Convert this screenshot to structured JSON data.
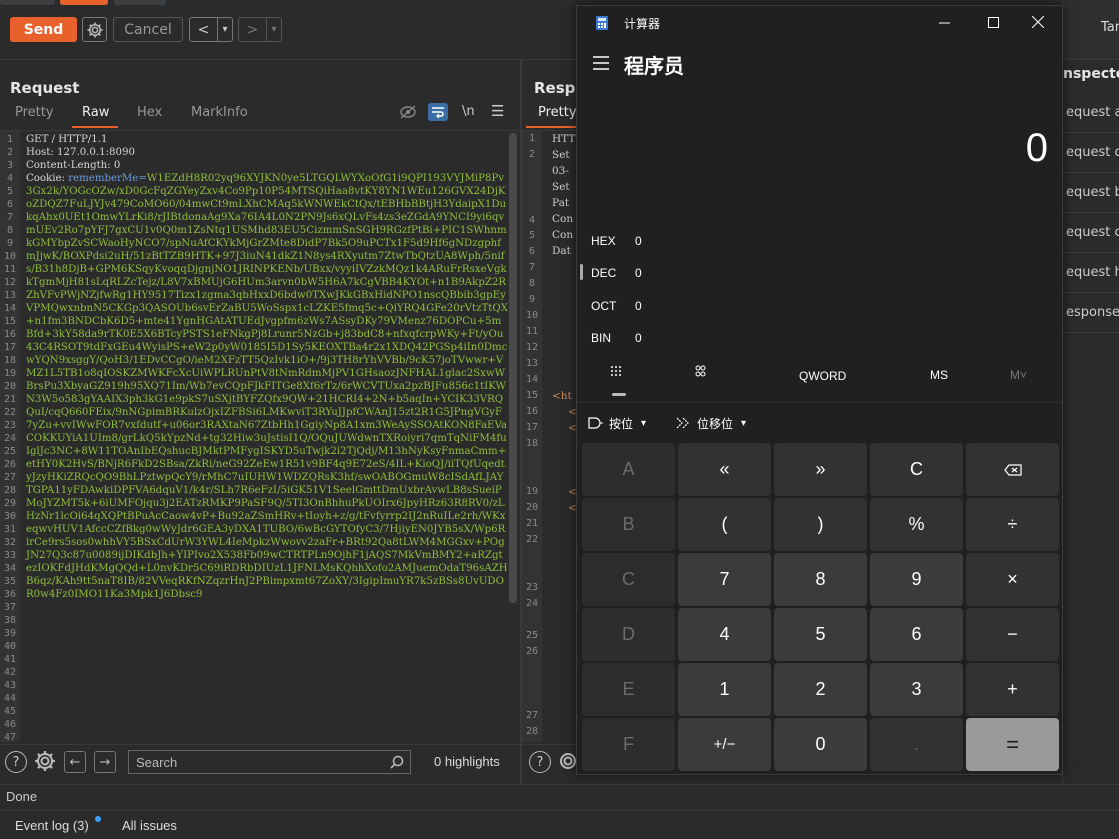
{
  "toolbar": {
    "send": "Send",
    "cancel": "Cancel",
    "back": "<",
    "forward": ">",
    "dropdown": "▾"
  },
  "request": {
    "title": "Request",
    "tabs": [
      "Pretty",
      "Raw",
      "Hex",
      "MarkInfo"
    ],
    "newline_label": "\\n",
    "line_numbers": [
      "1",
      "2",
      "3",
      "4",
      "5",
      "6",
      "7",
      "8",
      "9",
      "10",
      "11",
      "12",
      "13",
      "14",
      "15",
      "16",
      "17",
      "18",
      "19",
      "20",
      "21",
      "22",
      "23",
      "24",
      "25",
      "26",
      "27",
      "28",
      "29",
      "30",
      "31",
      "32",
      "33",
      "34",
      "35",
      "36",
      "37",
      "38",
      "39",
      "40",
      "41",
      "42",
      "43",
      "44",
      "45",
      "46",
      "47"
    ],
    "lines": [
      "GET / HTTP/1.1",
      "Host: 127.0.0.1:8090",
      "Content-Length: 0",
      "Cookie: "
    ],
    "cookie_name": "rememberMe=",
    "cookie_value": "W1EZdH8R02yq96XYJKN0ye5LTGQLWYXoOfG1i9QPI193VYJMiP8Pv3Gx2k/YOGcOZw/xD0GcFqZGYeyZxv4Co9Pp10P54MTSQiHaa8vtKY8YN1WEu126GVX24DjKoZDQZ7FuLJYJv479CoMO60/04mwCt9mLXhCMAq5kWNWEkCtQx/tEBHbBBtjH3YdaipX1DukqAhx0UEt1OmwYLrKi8/rJIBtdonaAg9Xa76IA4L0N2PN9Js6xQLvFs4zs3eZGdA9YNCI9yi6qvmUEv2Ro7pYFJ7gxCU1v0Q0m1ZsNtq1USMhd83EU5CizmmSnSGH9RGzfPtBi+PIC1SWhnmkGMYbpZvSCWaoHyNCO7/spNuAfCKYkMjGrZMte8DidP7Bk5O9uPCTx1F5d9Hf6gNDzgphfmJjwK/BOXPdsi2uH/51zBtTZB9HTK+97J3iuN41dkZ1N8ys4RXyutm7ZtwTbQtzUA8Wph/5nifs/B31h8DjB+GPM6KSqyKvoqqDjgnjNO1JRINPKENb/UBxx/vyyiIVZzkMQz1k4ARuFrRsxeVgkkTgmMjH81sLqRLZcTejz/L8V7xBMUjG6HUm3arvn0bW5H6A7kCgVBB4KYOt+n1B9AkpZ2RZhVFvPWjNZjfwRg1HY9517Tizx1zgma3qbHxxD6bdw0TXwJKkGBxHidNPO1nscQBbib3gpEyVPMQwxnbnN5CKGp3QASOUb6svErZaBU5WoSspx1cLZKE5fmq5c+QiYRQ4GFe20rVtzTtQX+n1fm3BNDCbK6D5+mte41YgnHGAtATUEdJvgpfm6zWs7ASsyDKy79VMenz76DOPCu+5mBfd+3kY58da9rTK0E5X6BTcyPSTS1eFNkgPj8Lrunr5NzGb+j83bdC8+nfxqfcrpWKy+Ft/yOu43C4RSOT9tdFxGEu4WyisPS+eW2p0yW0185I5D1Sy5KEOXTBa4r2x1XDQ42PGSp4iIn0DmcwYQN9xsggY/QoH3/1EDvCCgO/ieM2XFzTT5QzIvk1iO+/9j3TH8rYhVVBb/9cK57joTVwwr+VMZ1L5TB1o8qIOSKZMWKFcXcUiWPLRUnPtV8tNmRdmMjPV1GHsaozJNFHAL1glac2SxwWBrsPu3XbyaGZ919h95XQ71Im/Wb7evCQpFJkFITGe8Xf6rTz/6rWCVTUxa2pzBJFu856c1tIKWN3W5o583gYAAIX3ph3kG1e9pkS7uSXjtBYFZQfx9QW+21HCRI4+2N+b5aqIn+YCIK33VRQQuI/cqQ660FEix/9nNGpimBRKulzOjxIZFBSi6LMKwviT3RYuJJpfCWAnJ15zt2R1G5JPngVGyF7yZu+vvIWwFOR7vxfdutf+u06or3RAXtaN67ZtbHh1GgiyNp8A1xm3WeAySSOAtKON8FaEVaCOKKUYiA1UIm8/grLkQ5kYpzNd+tg32Hiw3uJstisI1Q/OQuJUWdwnTXRoiyri7qmTqNiFM4fuIglJc3NC+8W11TOAnIbEQshucBJMktPMFygISKYD5uTwjk2i2TjQdj/M13hNyKsyFnmaCmm+etHY0K2HvS/BNjR6FkD2SBsa/ZkRi/neG92ZeEw1R51v9BF4q9E72eS/4IL+KioQJ/iiTQfUqedtyJzyHKiZRQcQO9BhLPztwpQcY9/rMhC7uIUHW1WDZQRsK3hf/swOABOGmuW8cISdAfLJAYTGPA11yFDAwkiDPFVA6dquV1/k4r/SLh7R6eFzI/5iGK51V1SeelGmttDmUxbrAvwLB8sSueiPMoJYZMT5k+6iUMFOjqu3j2EATzRMKP9PaSF9Q/5TI3OnBhhuPkUOIrx6JpyHRz63R8RV0/zLHzNr1lcOi64qXQPtBPuAcCaow4vP+Bu92aZSmHRv+tIoyh+z/g/tFvfyrrp2IJ2nRuILe2rh/WKxeqwvHUV1AfccCZfBkg0wWyJdr6GEA3yDXA1TUBO/6wBcGYTOfyC3/7HjiyEN0JYB5sX/Wp6RirCe9rs5sos0whhVY5BSxCdUrW3YWL4IeMpkzWwovv2zaFr+BRt92Qa8tLWM4MGGxv+POgJN27Q3c87u0089ijDIKdbJh+YIPIvo2X538Fb09wCTRTPLn9OjhF1jAQS7MkVmBMY2+aRZgtezIOKFdJHdKMgQQd+L0nvKDr5C69iRDRbDIUzL1JFNLMsKQhhXofo2AMJuemOdaT96sAZHB6qz/KAh9tt5naT8IB/82VVeqRKfNZqzrHnJ2PBimpxmt67ZoXY/3IgipImuYR7k5zBSs8UvUDOR0w4Fz0IMO11Ka3Mpk1J6Dbsc9"
  },
  "response": {
    "title": "Respo",
    "tab": "Pretty",
    "line_numbers": [
      "1",
      "2",
      "3",
      "4",
      "5",
      "6",
      "7",
      "8",
      "9",
      "10",
      "11",
      "12",
      "13",
      "14",
      "15",
      "16",
      "17",
      "18",
      "19",
      "20",
      "21",
      "22",
      "23",
      "24",
      "25",
      "26",
      "27",
      "28"
    ],
    "fragments": [
      "HTT",
      "Set",
      "03-",
      "Set",
      "Pat",
      "Con",
      "Con",
      "Dat",
      "<ht",
      "<",
      "<",
      "<",
      "<"
    ]
  },
  "search": {
    "placeholder": "Search",
    "highlights": "0 highlights"
  },
  "status": {
    "text": "Done"
  },
  "footer": {
    "event_log": "Event log (3)",
    "all_issues": "All issues"
  },
  "inspector": {
    "tab": "Tar",
    "title": "nspector",
    "items": [
      "equest at",
      "equest qu",
      "equest bo",
      "equest co",
      "equest he",
      "esponse h"
    ]
  },
  "calculator": {
    "window_title": "计算器",
    "mode": "程序员",
    "display": "0",
    "radix": [
      {
        "label": "HEX",
        "value": "0"
      },
      {
        "label": "DEC",
        "value": "0"
      },
      {
        "label": "OCT",
        "value": "0"
      },
      {
        "label": "BIN",
        "value": "0"
      }
    ],
    "word_size": "QWORD",
    "memory_store": "MS",
    "memory_recall": "M˅",
    "bitwise": "按位",
    "bitshift": "位移位",
    "keys": [
      [
        "A",
        "«",
        "»",
        "C",
        "⌫"
      ],
      [
        "B",
        "(",
        ")",
        "%",
        "÷"
      ],
      [
        "C",
        "7",
        "8",
        "9",
        "×"
      ],
      [
        "D",
        "4",
        "5",
        "6",
        "−"
      ],
      [
        "E",
        "1",
        "2",
        "3",
        "+"
      ],
      [
        "F",
        "+/−",
        "0",
        ".",
        "="
      ]
    ]
  }
}
